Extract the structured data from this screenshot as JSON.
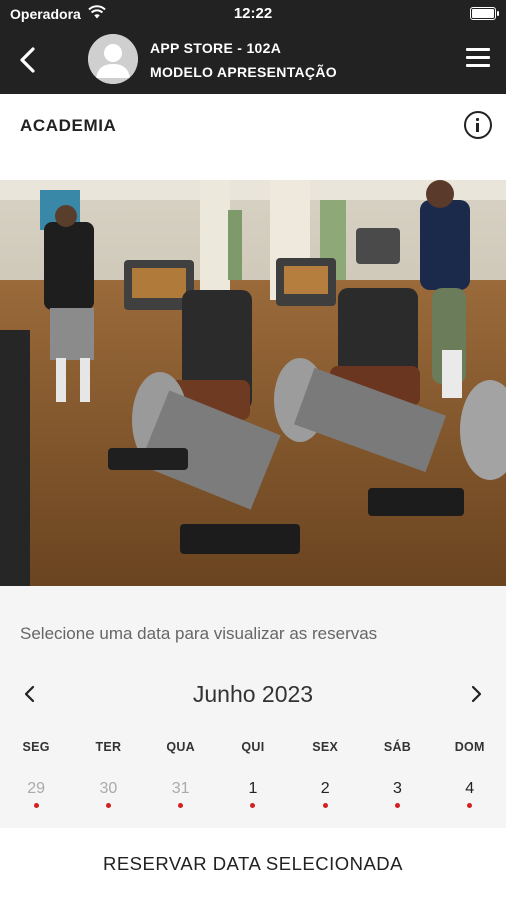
{
  "status_bar": {
    "carrier": "Operadora",
    "time": "12:22",
    "icons": [
      "wifi-icon",
      "battery-icon"
    ]
  },
  "header": {
    "title": "APP STORE - 102A",
    "subtitle": "MODELO APRESENTAÇÃO",
    "icons": [
      "chevron-left-icon",
      "avatar-icon",
      "hamburger-menu-icon"
    ]
  },
  "section": {
    "title": "ACADEMIA",
    "icon": "info-icon"
  },
  "photo": {
    "subject": "gym-exercise-bikes-photo"
  },
  "calendar": {
    "instruction": "Selecione uma data para visualizar as reservas",
    "month": "Junho 2023",
    "weekdays": [
      "SEG",
      "TER",
      "QUA",
      "QUI",
      "SEX",
      "SÁB",
      "DOM"
    ],
    "days": [
      {
        "label": "29",
        "in_month": false,
        "has_dot": true
      },
      {
        "label": "30",
        "in_month": false,
        "has_dot": true
      },
      {
        "label": "31",
        "in_month": false,
        "has_dot": true
      },
      {
        "label": "1",
        "in_month": true,
        "has_dot": true
      },
      {
        "label": "2",
        "in_month": true,
        "has_dot": true
      },
      {
        "label": "3",
        "in_month": true,
        "has_dot": true
      },
      {
        "label": "4",
        "in_month": true,
        "has_dot": true
      }
    ],
    "dot_color": "#d32020"
  },
  "reserve_button": {
    "label": "RESERVAR DATA SELECIONADA"
  },
  "colors": {
    "header_bg": "#222222",
    "calendar_bg": "#f5f5f5",
    "accent_dot": "#d32020"
  }
}
